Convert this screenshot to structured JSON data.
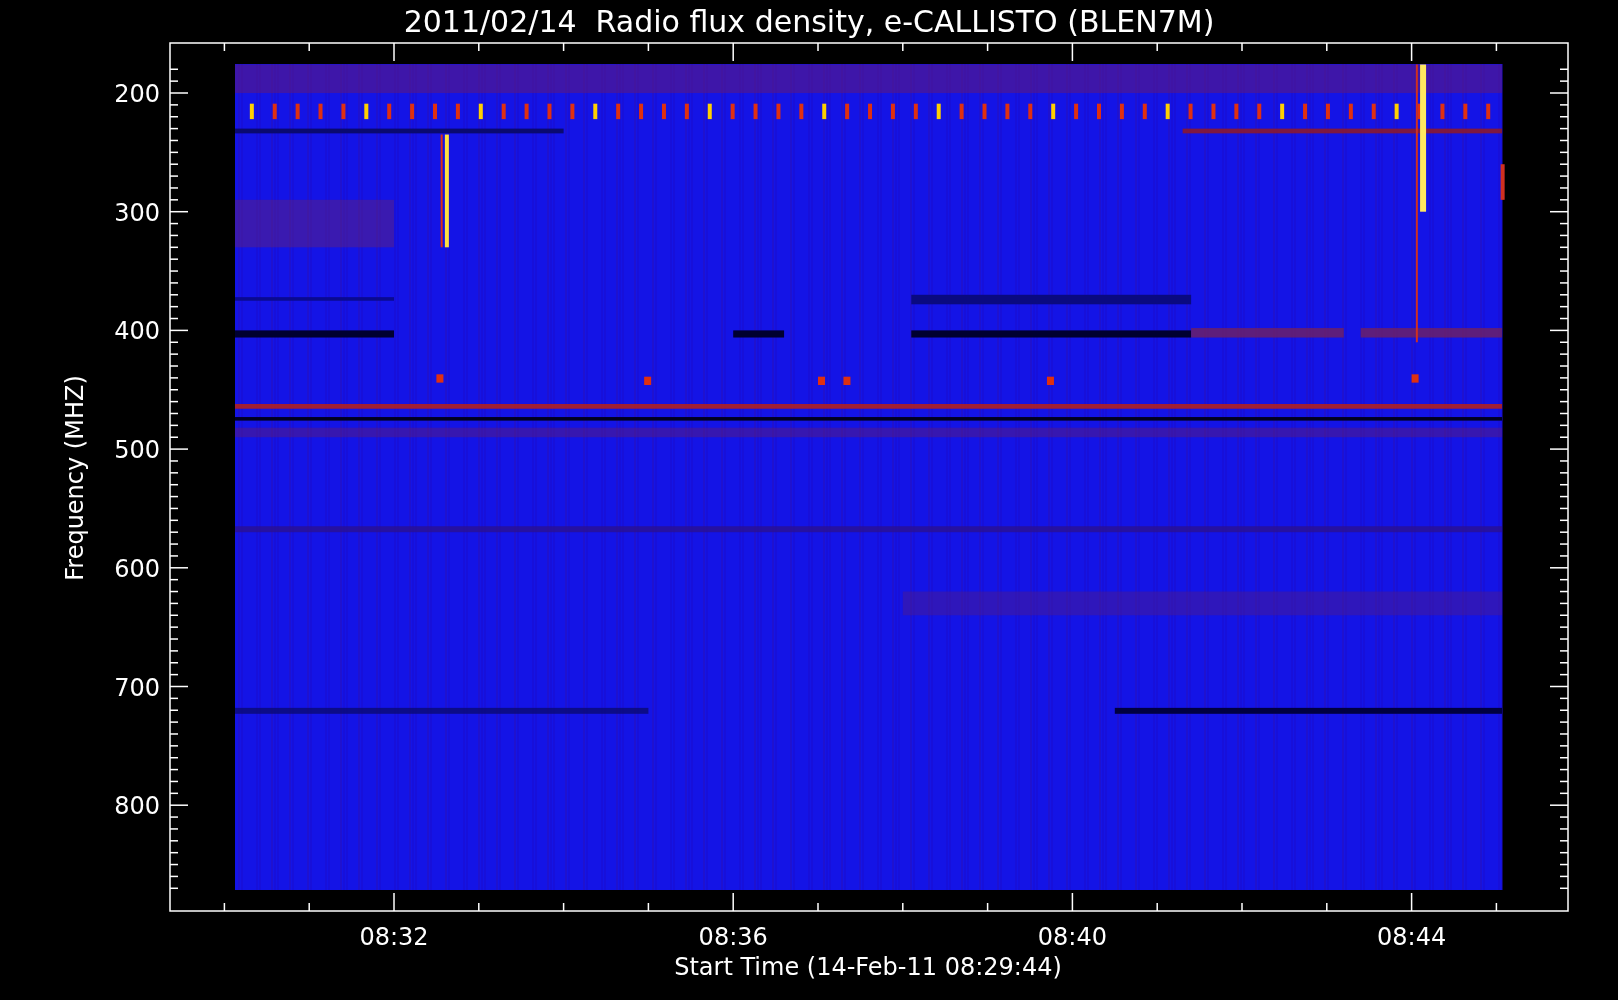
{
  "title": "2011/02/14  Radio flux density, e-CALLISTO (BLEN7M)",
  "y_axis": {
    "label": "Frequency (MHZ)",
    "ticks": [
      "200",
      "300",
      "400",
      "500",
      "600",
      "700",
      "800"
    ]
  },
  "x_axis": {
    "label": "Start Time (14-Feb-11 08:29:44)",
    "ticks": [
      "08:32",
      "08:36",
      "08:40",
      "08:44"
    ]
  }
}
